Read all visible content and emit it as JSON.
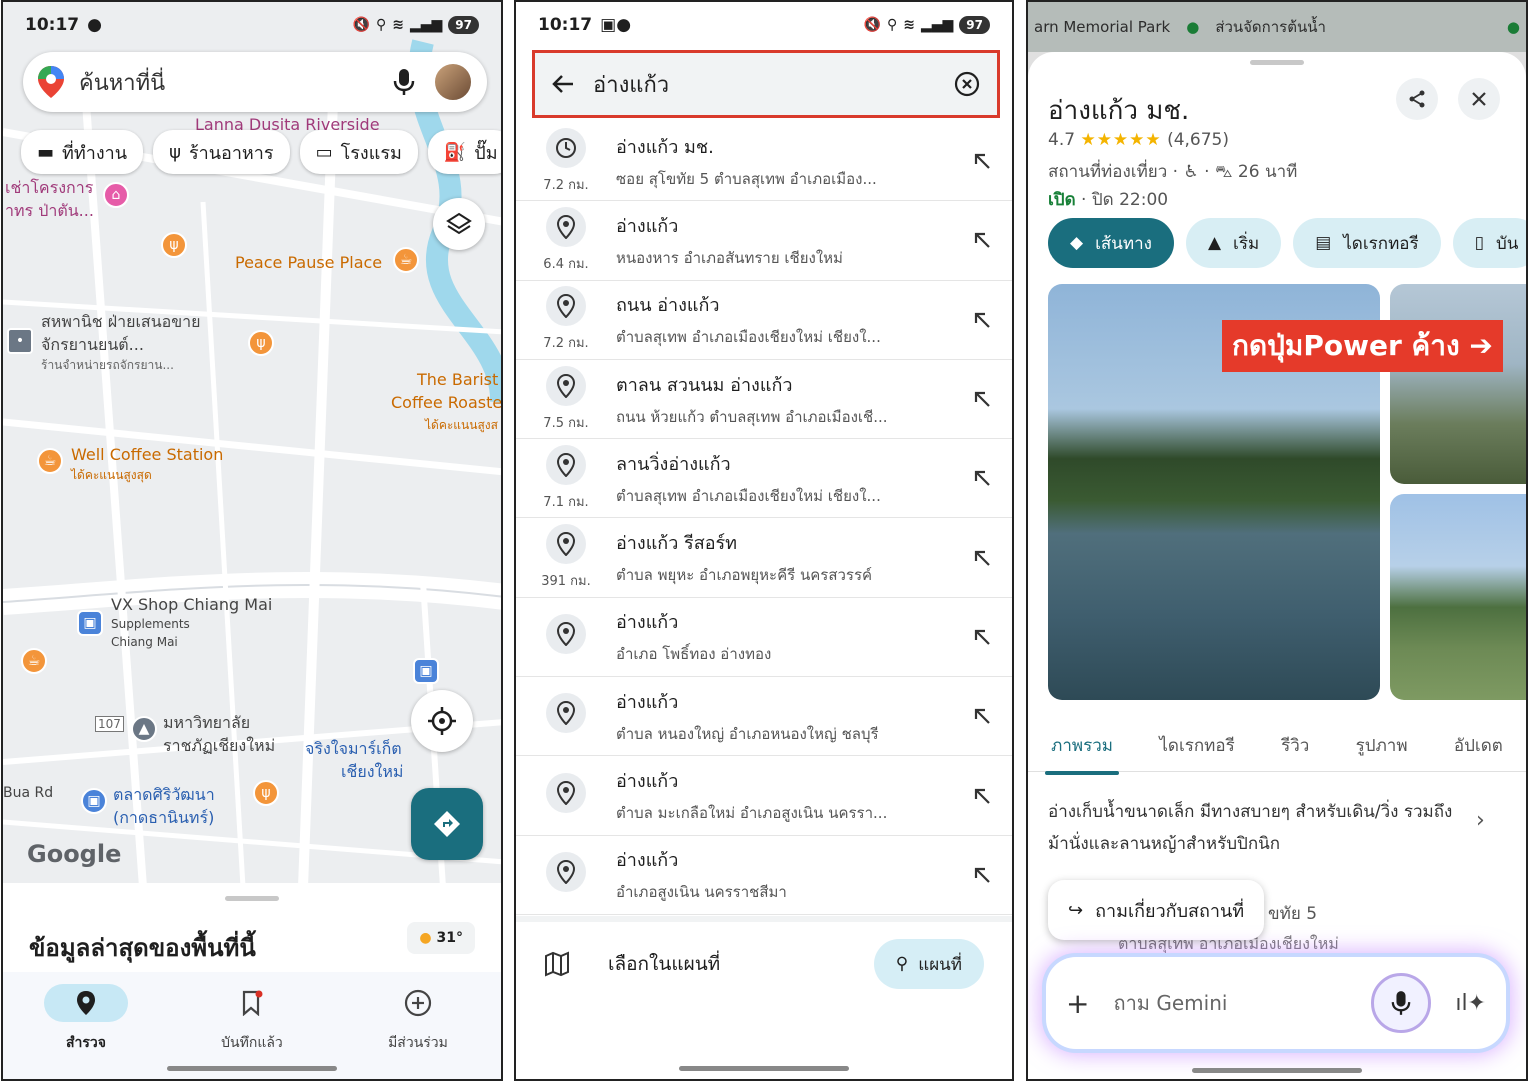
{
  "status_p1": {
    "time": "10:17",
    "battery": "97"
  },
  "status_p2": {
    "time": "10:17",
    "battery": "97"
  },
  "map_screen": {
    "search_placeholder": "ค้นหาที่นี่",
    "chips": [
      "ที่ทำงาน",
      "ร้านอาหาร",
      "โรงแรม",
      "ปั๊ม"
    ],
    "map_labels": {
      "lanna": "Lanna Dusita Riverside",
      "peace": "Peace Pause Place",
      "sahapanich": "สหพานิช ฝ่ายเสนอขาย",
      "sahapanich2": "จักรยานยนต์...",
      "sahapanich3": "ร้านจำหน่ายรถจักรยาน...",
      "barista1": "The Barist",
      "barista2": "Coffee Roaste",
      "barista3": "ได้คะแนนสูงส",
      "well": "Well Coffee Station",
      "well_sub": "ได้คะแนนสูงสุด",
      "vx": "VX Shop Chiang Mai",
      "vx_sub1": "Supplements",
      "vx_sub2": "Chiang Mai",
      "rajabhat1": "มหาวิทยาลัย",
      "rajabhat2": "ราชภัฏเชียงใหม่",
      "jingjai1": "จริงใจมาร์เก็ต",
      "jingjai2": "เชียงใหม่",
      "market1": "ตลาดศิริวัฒนา",
      "market2": "(กาดธานินทร์)",
      "buarod": "Bua Rd",
      "rent": "เช่าโครงการ",
      "rent2": "าทร ป่าตัน...",
      "road107": "107",
      "google": "Google"
    },
    "sheet_title": "ข้อมูลล่าสุดของพื้นที่นี้",
    "weather": "31°",
    "nav": [
      {
        "label": "สำรวจ",
        "active": true
      },
      {
        "label": "บันทึกแล้ว",
        "active": false
      },
      {
        "label": "มีส่วนร่วม",
        "active": false
      }
    ]
  },
  "search_screen": {
    "query": "อ่างแก้ว",
    "results": [
      {
        "icon": "history",
        "distance": "7.2 กม.",
        "title": "อ่างแก้ว มช.",
        "subtitle": "ซอย สุโขทัย 5 ตำบลสุเทพ อำเภอเมือง..."
      },
      {
        "icon": "pin",
        "distance": "6.4 กม.",
        "title": "อ่างแก้ว",
        "subtitle": "หนองหาร อำเภอสันทราย เชียงใหม่"
      },
      {
        "icon": "pin",
        "distance": "7.2 กม.",
        "title": "ถนน อ่างแก้ว",
        "subtitle": "ตำบลสุเทพ อำเภอเมืองเชียงใหม่ เชียงใ..."
      },
      {
        "icon": "pin",
        "distance": "7.5 กม.",
        "title": "ตาลน สวนนม อ่างแก้ว",
        "subtitle": "ถนน ห้วยแก้ว ตำบลสุเทพ อำเภอเมืองเชี..."
      },
      {
        "icon": "pin",
        "distance": "7.1 กม.",
        "title": "ลานวิ่งอ่างแก้ว",
        "subtitle": "ตำบลสุเทพ อำเภอเมืองเชียงใหม่ เชียงใ..."
      },
      {
        "icon": "pin",
        "distance": "391 กม.",
        "title": "อ่างแก้ว รีสอร์ท",
        "subtitle": "ตำบล พยุหะ อำเภอพยุหะคีรี นครสวรรค์"
      },
      {
        "icon": "pin",
        "distance": "",
        "title": "อ่างแก้ว",
        "subtitle": "อำเภอ โพธิ์ทอง อ่างทอง"
      },
      {
        "icon": "pin",
        "distance": "",
        "title": "อ่างแก้ว",
        "subtitle": "ตำบล หนองใหญ่ อำเภอหนองใหญ่ ชลบุรี"
      },
      {
        "icon": "pin",
        "distance": "",
        "title": "อ่างแก้ว",
        "subtitle": "ตำบล มะเกลือใหม่ อำเภอสูงเนิน นครรา..."
      },
      {
        "icon": "pin",
        "distance": "",
        "title": "อ่างแก้ว",
        "subtitle": "อำเภอสูงเนิน นครราชสีมา"
      }
    ],
    "choose_on_map": "เลือกในแผนที่",
    "map_button": "แผนที่"
  },
  "place_screen": {
    "top_labels": [
      "arn Memorial Park",
      "ส่วนจัดการต้นน้ำ"
    ],
    "title": "อ่างแก้ว มช.",
    "rating": "4.7",
    "stars": "★★★★★",
    "reviews": "(4,675)",
    "category": "สถานที่ท่องเที่ยว ·",
    "drive_time": "26 นาที",
    "open": "เปิด",
    "close_time": " · ปิด 22:00",
    "actions": [
      "เส้นทาง",
      "เริ่ม",
      "ไดเรกทอรี",
      "บัน"
    ],
    "banner": "กดปุ่มPower ค้าง",
    "tabs": [
      "ภาพรวม",
      "ไดเรกทอรี",
      "รีวิว",
      "รูปภาพ",
      "อัปเดต"
    ],
    "description": "อ่างเก็บน้ำขนาดเล็ก มีทางสบายๆ สำหรับเดิน/วิ่ง รวมถึงม้านั่งและลานหญ้าสำหรับปิกนิก",
    "ask_chip": "ถามเกี่ยวกับสถานที่",
    "behind_text": "ขทัย 5",
    "behind_text2": "ตำบลสุเทพ อำเภอเมืองเชียงใหม่",
    "gemini_placeholder": "ถาม Gemini"
  },
  "colors": {
    "accent": "#1a6e7e",
    "highlight_red": "#d93a2b",
    "banner_red": "#e53a2a"
  }
}
